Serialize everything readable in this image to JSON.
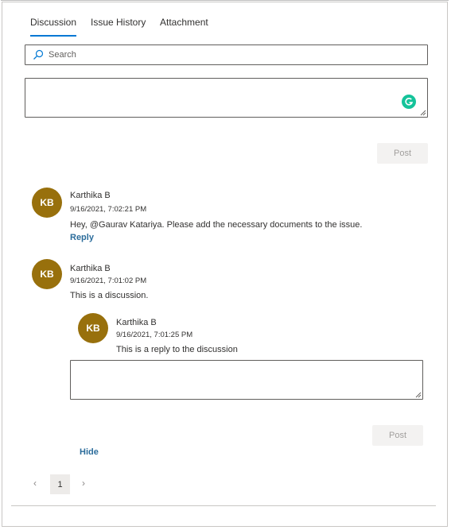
{
  "tabs": [
    {
      "label": "Discussion",
      "active": true
    },
    {
      "label": "Issue History",
      "active": false
    },
    {
      "label": "Attachment",
      "active": false
    }
  ],
  "search": {
    "placeholder": "Search",
    "icon": "search-icon"
  },
  "composer": {
    "post_label": "Post",
    "grammarly_letter": "G"
  },
  "comments": [
    {
      "initials": "KB",
      "author": "Karthika B",
      "timestamp": "9/16/2021, 7:02:21 PM",
      "text": "Hey, @Gaurav Katariya. Please add the necessary documents to the issue.",
      "action": "Reply"
    },
    {
      "initials": "KB",
      "author": "Karthika B",
      "timestamp": "9/16/2021, 7:01:02 PM",
      "text": "This is a discussion.",
      "reply": {
        "initials": "KB",
        "author": "Karthika B",
        "timestamp": "9/16/2021, 7:01:25 PM",
        "text": "This is a reply to the discussion"
      },
      "reply_post_label": "Post",
      "action": "Hide"
    }
  ],
  "pagination": {
    "prev": "‹",
    "current": "1",
    "next": "›"
  },
  "colors": {
    "accent": "#0078d4",
    "avatar": "#98700c",
    "link": "#2b6c9b",
    "grammarly": "#15c39a"
  }
}
